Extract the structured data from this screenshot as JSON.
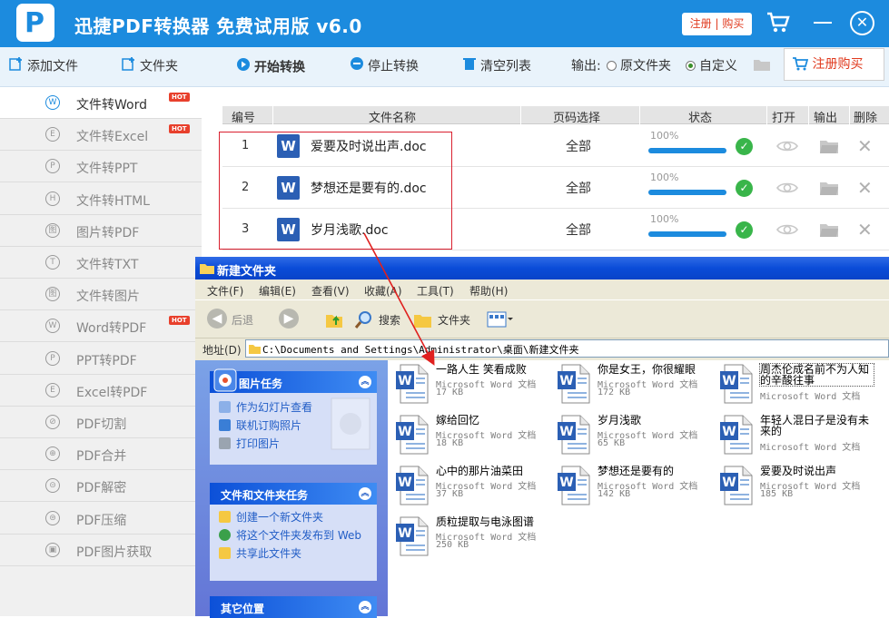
{
  "app": {
    "title": "迅捷PDF转换器 免费试用版 v6.0",
    "register_buy_top": "注册 | 购买"
  },
  "toolbar": {
    "add_file": "添加文件",
    "folder": "文件夹",
    "start": "开始转换",
    "stop": "停止转换",
    "clear": "清空列表",
    "output_label": "输出:",
    "opt_original": "原文件夹",
    "opt_custom": "自定义",
    "register_buy": "注册购买"
  },
  "sidebar": {
    "items": [
      {
        "label": "文件转Word",
        "icon": "W",
        "hot": "HOT"
      },
      {
        "label": "文件转Excel",
        "icon": "E",
        "hot": "HOT"
      },
      {
        "label": "文件转PPT",
        "icon": "P",
        "hot": ""
      },
      {
        "label": "文件转HTML",
        "icon": "H",
        "hot": ""
      },
      {
        "label": "图片转PDF",
        "icon": "图",
        "hot": ""
      },
      {
        "label": "文件转TXT",
        "icon": "T",
        "hot": ""
      },
      {
        "label": "文件转图片",
        "icon": "图",
        "hot": ""
      },
      {
        "label": "Word转PDF",
        "icon": "W",
        "hot": "HOT"
      },
      {
        "label": "PPT转PDF",
        "icon": "P",
        "hot": ""
      },
      {
        "label": "Excel转PDF",
        "icon": "E",
        "hot": ""
      },
      {
        "label": "PDF切割",
        "icon": "⊘",
        "hot": ""
      },
      {
        "label": "PDF合并",
        "icon": "⊕",
        "hot": ""
      },
      {
        "label": "PDF解密",
        "icon": "⊝",
        "hot": ""
      },
      {
        "label": "PDF压缩",
        "icon": "⊜",
        "hot": ""
      },
      {
        "label": "PDF图片获取",
        "icon": "▣",
        "hot": ""
      }
    ]
  },
  "table": {
    "headers": [
      "编号",
      "文件名称",
      "页码选择",
      "状态",
      "打开",
      "输出",
      "删除"
    ],
    "rows": [
      {
        "num": "1",
        "name": "爱要及时说出声.doc",
        "pages": "全部",
        "progress": "100%",
        "progress_value": 1.0
      },
      {
        "num": "2",
        "name": "梦想还是要有的.doc",
        "pages": "全部",
        "progress": "100%",
        "progress_value": 1.0
      },
      {
        "num": "3",
        "name": "岁月浅歌.doc",
        "pages": "全部",
        "progress": "100%",
        "progress_value": 1.0
      }
    ]
  },
  "explorer": {
    "title": "新建文件夹",
    "menu": [
      "文件(F)",
      "编辑(E)",
      "查看(V)",
      "收藏(A)",
      "工具(T)",
      "帮助(H)"
    ],
    "back": "后退",
    "search": "搜索",
    "folders": "文件夹",
    "address_label": "地址(D)",
    "address": "C:\\Documents and Settings\\Administrator\\桌面\\新建文件夹",
    "panels": {
      "picture_tasks": {
        "title": "图片任务",
        "items": [
          "作为幻灯片查看",
          "联机订购照片",
          "打印图片"
        ]
      },
      "file_tasks": {
        "title": "文件和文件夹任务",
        "items": [
          "创建一个新文件夹",
          "将这个文件夹发布到 Web",
          "共享此文件夹"
        ]
      },
      "other": {
        "title": "其它位置"
      }
    },
    "file_type": "Microsoft Word 文档",
    "files": [
      {
        "name": "一路人生 笑看成败",
        "size": "17 KB"
      },
      {
        "name": "你是女王，你很耀眼",
        "size": "172 KB"
      },
      {
        "name": "周杰伦成名前不为人知的辛酸往事",
        "size": ""
      },
      {
        "name": "嫁给回忆",
        "size": "18 KB"
      },
      {
        "name": "岁月浅歌",
        "size": "65 KB"
      },
      {
        "name": "年轻人混日子是没有未来的",
        "size": ""
      },
      {
        "name": "心中的那片油菜田",
        "size": "37 KB"
      },
      {
        "name": "梦想还是要有的",
        "size": "142 KB"
      },
      {
        "name": "爱要及时说出声",
        "size": "185 KB"
      },
      {
        "name": "质粒提取与电泳图谱",
        "size": "250 KB"
      }
    ]
  }
}
